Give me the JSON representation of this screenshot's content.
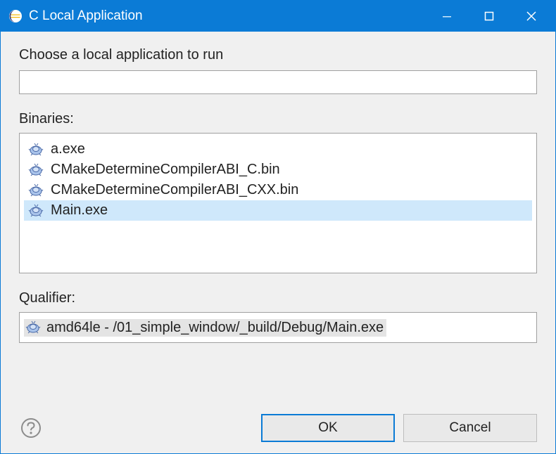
{
  "window": {
    "title": "C Local Application"
  },
  "prompt": "Choose a local application to run",
  "filter_value": "",
  "binaries_label": "Binaries:",
  "binaries": [
    {
      "label": "a.exe",
      "selected": false
    },
    {
      "label": "CMakeDetermineCompilerABI_C.bin",
      "selected": false
    },
    {
      "label": "CMakeDetermineCompilerABI_CXX.bin",
      "selected": false
    },
    {
      "label": "Main.exe",
      "selected": true
    }
  ],
  "qualifier_label": "Qualifier:",
  "qualifier": {
    "label": "amd64le - /01_simple_window/_build/Debug/Main.exe"
  },
  "buttons": {
    "ok": "OK",
    "cancel": "Cancel"
  }
}
